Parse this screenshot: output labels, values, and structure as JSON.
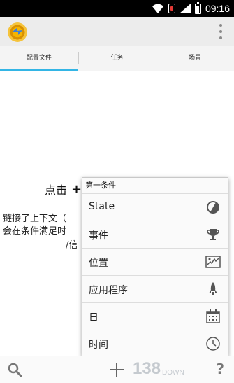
{
  "status_bar": {
    "time": "09:16",
    "icons": [
      "wifi-icon",
      "sim-icon",
      "signal-icon",
      "battery-icon"
    ]
  },
  "action_bar": {
    "app_icon": "tasker-gear-icon",
    "overflow_icon": "overflow-menu-icon"
  },
  "tabs": [
    {
      "label": "配置文件",
      "active": true
    },
    {
      "label": "任务",
      "active": false
    },
    {
      "label": "场景",
      "active": false
    }
  ],
  "hint": {
    "line1": "点击",
    "plus": "+",
    "line2": "链接了上下文（",
    "line3": "会在条件满足时",
    "line4": "/信"
  },
  "popup": {
    "title": "第一条件",
    "items": [
      {
        "label": "State",
        "icon": "state-icon"
      },
      {
        "label": "事件",
        "icon": "trophy-icon"
      },
      {
        "label": "位置",
        "icon": "map-icon"
      },
      {
        "label": "应用程序",
        "icon": "rocket-icon"
      },
      {
        "label": "日",
        "icon": "calendar-icon"
      },
      {
        "label": "时间",
        "icon": "clock-icon"
      }
    ]
  },
  "bottom_bar": {
    "search_icon": "search-icon",
    "add_icon": "plus-icon",
    "help_label": "?",
    "watermark_number": "138",
    "watermark_text": "DOWN"
  },
  "colors": {
    "accent": "#33b5e5",
    "status_bar": "#000000",
    "action_bar": "#ececec"
  }
}
